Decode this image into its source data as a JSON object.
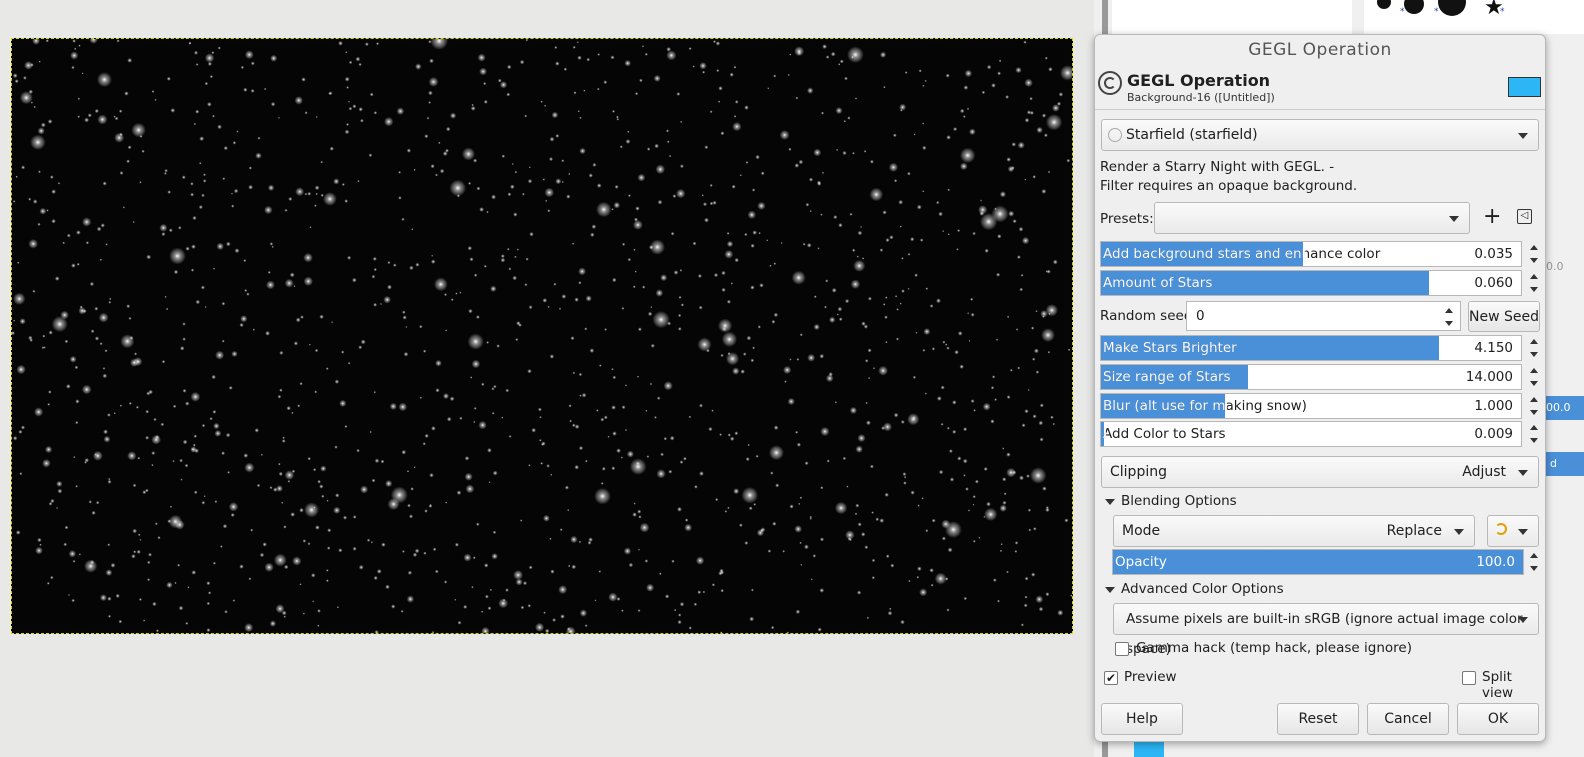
{
  "dialog": {
    "window_title": "GEGL Operation",
    "header_title": "GEGL Operation",
    "header_subtitle": "Background-16 ([Untitled])",
    "swatch_color": "#2db6f5",
    "operation": "Starfield (starfield)",
    "description_line1": "Render a Starry Night with GEGL. -",
    "description_line2": "Filter requires an opaque background.",
    "presets_label": "Presets:",
    "presets_value": "",
    "sliders": [
      {
        "label": "Add background stars and enhance color",
        "value": "0.035",
        "fill_fraction": 0.48
      },
      {
        "label": "Amount of Stars",
        "value": "0.060",
        "fill_fraction": 0.78
      },
      {
        "label": "Make Stars Brighter",
        "value": "4.150",
        "fill_fraction": 0.805
      },
      {
        "label": "Size range of Stars",
        "value": "14.000",
        "fill_fraction": 0.35
      },
      {
        "label": "Blur (alt use for making snow)",
        "value": "1.000",
        "fill_fraction": 0.295
      },
      {
        "label": "Add Color to Stars",
        "value": "0.009",
        "fill_fraction": 0.008
      }
    ],
    "random_seed_label": "Random seed",
    "random_seed_value": "0",
    "new_seed_button": "New Seed",
    "clipping_label": "Clipping",
    "clipping_value": "Adjust",
    "blending_section": "Blending Options",
    "mode_label": "Mode",
    "mode_value": "Replace",
    "opacity_label": "Opacity",
    "opacity_value": "100.0",
    "advanced_section": "Advanced Color Options",
    "color_space_value": "Assume pixels are built-in sRGB (ignore actual image color space)",
    "gamma_hack_label": "Gamma hack (temp hack, please ignore)",
    "preview_label": "Preview",
    "split_view_label": "Split view",
    "buttons": {
      "help": "Help",
      "reset": "Reset",
      "cancel": "Cancel",
      "ok": "OK"
    }
  },
  "right_panel": {
    "partial_value1": "0.0",
    "partial_value2": "00.0",
    "partial_text": "d"
  }
}
